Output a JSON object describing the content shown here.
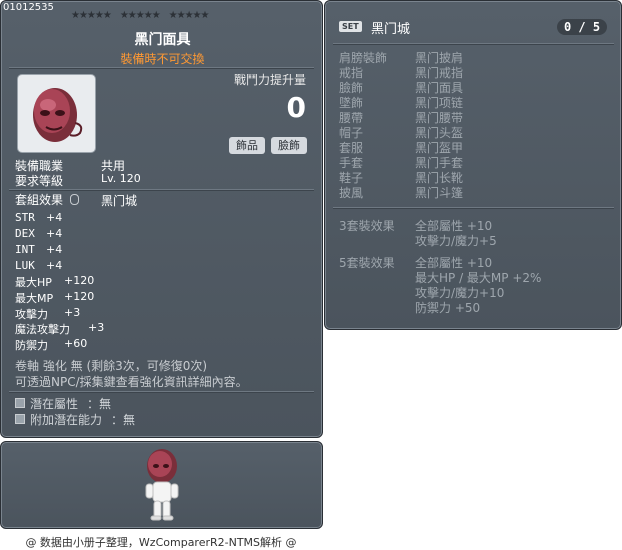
{
  "item": {
    "id": "01012535",
    "name": "黑门面具",
    "trade_note": "裝備時不可交換",
    "power_label": "戰鬥力提升量",
    "power_value": "0",
    "tags": [
      "飾品",
      "臉飾"
    ],
    "requirements": [
      {
        "label": "裝備職業",
        "value": "共用"
      },
      {
        "label": "要求等級",
        "value": "Lv. 120"
      }
    ],
    "set_label": "套組效果",
    "set_name": "黑门城",
    "stats": [
      {
        "key": "STR",
        "value": "+4"
      },
      {
        "key": "DEX",
        "value": "+4"
      },
      {
        "key": "INT",
        "value": "+4"
      },
      {
        "key": "LUK",
        "value": "+4"
      },
      {
        "key": "最大HP",
        "value": "+120"
      },
      {
        "key": "最大MP",
        "value": "+120"
      },
      {
        "key": "攻擊力",
        "value": "+3"
      },
      {
        "key": "魔法攻擊力",
        "value": "+3"
      },
      {
        "key": "防禦力",
        "value": "+60"
      }
    ],
    "scroll_line": "卷軸 強化 無 (剩餘3次，可修復0次)",
    "scroll_line2": "可透過NPC/採集鍵查看強化資訊詳細內容。",
    "potentials": [
      {
        "label": "潛在屬性",
        "value": "：無"
      },
      {
        "label": "附加潛在能力",
        "value": "：無"
      }
    ]
  },
  "set_panel": {
    "badge": "SET",
    "name": "黑门城",
    "count": "0 / 5",
    "pieces": [
      {
        "slot": "肩膀裝飾",
        "name": "黑门披肩"
      },
      {
        "slot": "戒指",
        "name": "黑门戒指"
      },
      {
        "slot": "臉飾",
        "name": "黑门面具"
      },
      {
        "slot": "墜飾",
        "name": "黑门项链"
      },
      {
        "slot": "腰帶",
        "name": "黑门腰带"
      },
      {
        "slot": "帽子",
        "name": "黑门头盔"
      },
      {
        "slot": "套服",
        "name": "黑门盔甲"
      },
      {
        "slot": "手套",
        "name": "黑门手套"
      },
      {
        "slot": "鞋子",
        "name": "黑门长靴"
      },
      {
        "slot": "披風",
        "name": "黑门斗篷"
      }
    ],
    "effect3_label": "3套裝效果",
    "effect3_lines": [
      "全部屬性 +10",
      "攻擊力/魔力+5"
    ],
    "effect5_label": "5套裝效果",
    "effect5_lines": [
      "全部屬性 +10",
      "最大HP / 最大MP +2%",
      "攻擊力/魔力+10",
      "防禦力 +50"
    ]
  },
  "footer": "@ 数据由小册子整理，WzComparerR2-NTMS解析 @",
  "colors": {
    "panel": "#4f5861",
    "accent_orange": "#ff9933",
    "icon_bg": "#e9ecef"
  },
  "icons": {
    "item": "black-mask-icon",
    "preview": "character-preview"
  }
}
